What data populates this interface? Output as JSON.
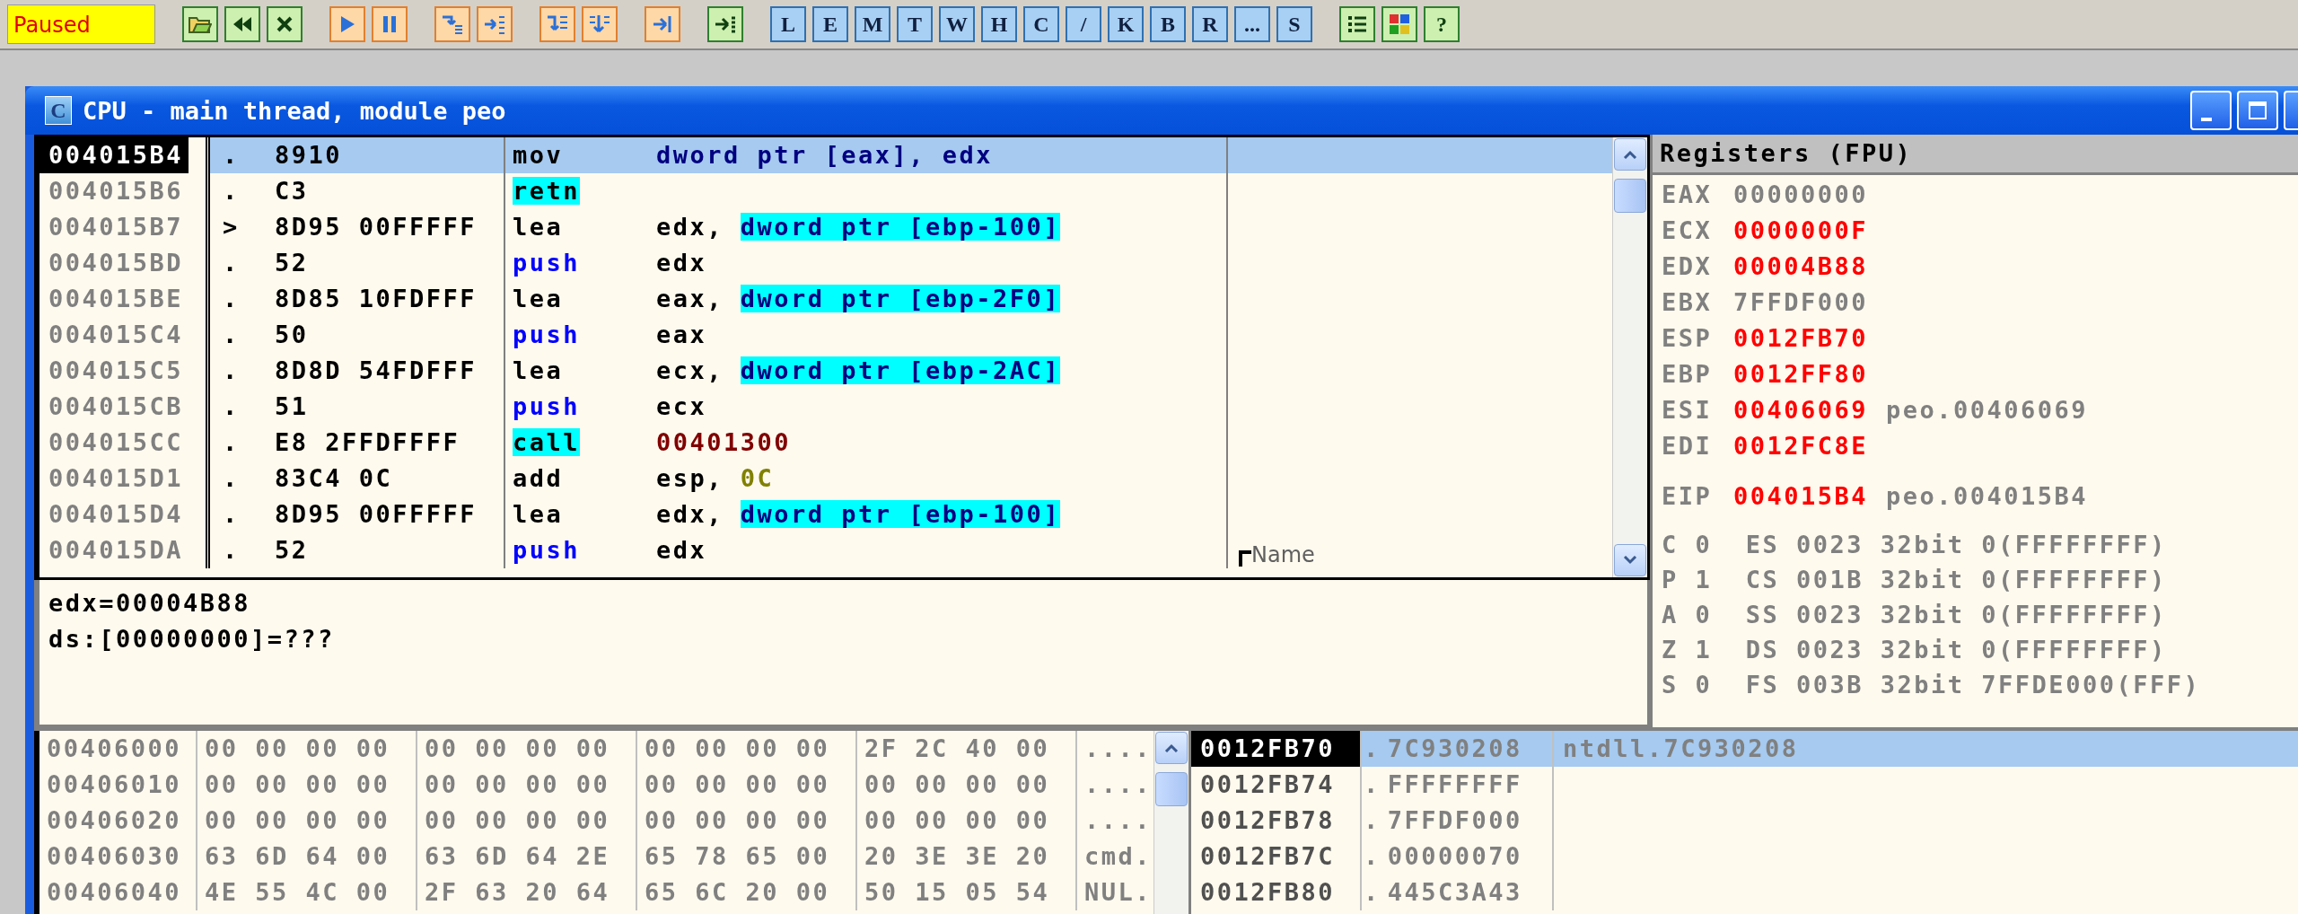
{
  "toolbar": {
    "status": "Paused",
    "letter_buttons": [
      "L",
      "E",
      "M",
      "T",
      "W",
      "H",
      "C",
      "/",
      "K",
      "B",
      "R",
      "...",
      "S"
    ],
    "help_button": "?"
  },
  "window": {
    "icon_letter": "C",
    "title": "CPU - main thread, module peo"
  },
  "disassembly": [
    {
      "address": "004015B4",
      "selected": true,
      "mark": ".",
      "hex": "8910",
      "mnemonic": {
        "text": "mov",
        "kind": "plain"
      },
      "operands": [
        {
          "text": "dword ptr [eax], edx",
          "kind": "memory_write"
        }
      ]
    },
    {
      "address": "004015B6",
      "selected": false,
      "mark": ".",
      "hex": "C3",
      "mnemonic": {
        "text": "retn",
        "kind": "jump"
      }
    },
    {
      "address": "004015B7",
      "selected": false,
      "mark": ">",
      "hex": "8D95 00FFFFF",
      "mnemonic": {
        "text": "lea",
        "kind": "plain"
      },
      "operands": [
        {
          "text": "edx, ",
          "kind": "plain"
        },
        {
          "text": "dword ptr [ebp-100]",
          "kind": "memory"
        }
      ]
    },
    {
      "address": "004015BD",
      "selected": false,
      "mark": ".",
      "hex": "52",
      "mnemonic": {
        "text": "push",
        "kind": "stack"
      },
      "operands": [
        {
          "text": "edx",
          "kind": "plain"
        }
      ]
    },
    {
      "address": "004015BE",
      "selected": false,
      "mark": ".",
      "hex": "8D85 10FDFFF",
      "mnemonic": {
        "text": "lea",
        "kind": "plain"
      },
      "operands": [
        {
          "text": "eax, ",
          "kind": "plain"
        },
        {
          "text": "dword ptr [ebp-2F0]",
          "kind": "memory"
        }
      ]
    },
    {
      "address": "004015C4",
      "selected": false,
      "mark": ".",
      "hex": "50",
      "mnemonic": {
        "text": "push",
        "kind": "stack"
      },
      "operands": [
        {
          "text": "eax",
          "kind": "plain"
        }
      ]
    },
    {
      "address": "004015C5",
      "selected": false,
      "mark": ".",
      "hex": "8D8D 54FDFFF",
      "mnemonic": {
        "text": "lea",
        "kind": "plain"
      },
      "operands": [
        {
          "text": "ecx, ",
          "kind": "plain"
        },
        {
          "text": "dword ptr [ebp-2AC]",
          "kind": "memory"
        }
      ]
    },
    {
      "address": "004015CB",
      "selected": false,
      "mark": ".",
      "hex": "51",
      "mnemonic": {
        "text": "push",
        "kind": "stack"
      },
      "operands": [
        {
          "text": "ecx",
          "kind": "plain"
        }
      ]
    },
    {
      "address": "004015CC",
      "selected": false,
      "mark": ".",
      "hex": "E8 2FFDFFFF",
      "mnemonic": {
        "text": "call",
        "kind": "jump"
      },
      "operands": [
        {
          "text": "00401300",
          "kind": "address"
        }
      ]
    },
    {
      "address": "004015D1",
      "selected": false,
      "mark": ".",
      "hex": "83C4 0C",
      "mnemonic": {
        "text": "add",
        "kind": "plain"
      },
      "operands": [
        {
          "text": "esp, ",
          "kind": "plain"
        },
        {
          "text": "0C",
          "kind": "constant"
        }
      ]
    },
    {
      "address": "004015D4",
      "selected": false,
      "mark": ".",
      "hex": "8D95 00FFFFF",
      "mnemonic": {
        "text": "lea",
        "kind": "plain"
      },
      "operands": [
        {
          "text": "edx, ",
          "kind": "plain"
        },
        {
          "text": "dword ptr [ebp-100]",
          "kind": "memory"
        }
      ]
    },
    {
      "address": "004015DA",
      "selected": false,
      "mark": ".",
      "hex": "52",
      "mnemonic": {
        "text": "push",
        "kind": "stack"
      },
      "operands": [
        {
          "text": "edx",
          "kind": "plain"
        }
      ],
      "comment": "Name"
    }
  ],
  "info": [
    "edx=00004B88",
    "ds:[00000000]=???"
  ],
  "registers": {
    "title": "Registers (FPU)",
    "general": [
      {
        "name": "EAX",
        "value": "00000000",
        "changed": false
      },
      {
        "name": "ECX",
        "value": "0000000F",
        "changed": true
      },
      {
        "name": "EDX",
        "value": "00004B88",
        "changed": true
      },
      {
        "name": "EBX",
        "value": "7FFDF000",
        "changed": false
      },
      {
        "name": "ESP",
        "value": "0012FB70",
        "changed": true
      },
      {
        "name": "EBP",
        "value": "0012FF80",
        "changed": true
      },
      {
        "name": "ESI",
        "value": "00406069",
        "changed": true,
        "comment": "peo.00406069"
      },
      {
        "name": "EDI",
        "value": "0012FC8E",
        "changed": true
      }
    ],
    "eip": {
      "name": "EIP",
      "value": "004015B4",
      "changed": true,
      "comment": "peo.004015B4"
    },
    "flags": [
      "C 0  ES 0023 32bit 0(FFFFFFFF)",
      "P 1  CS 001B 32bit 0(FFFFFFFF)",
      "A 0  SS 0023 32bit 0(FFFFFFFF)",
      "Z 1  DS 0023 32bit 0(FFFFFFFF)",
      "S 0  FS 003B 32bit 7FFDE000(FFF)"
    ]
  },
  "dump": [
    {
      "address": "00406000",
      "groups": [
        "00 00 00 00",
        "00 00 00 00",
        "00 00 00 00",
        "2F 2C 40 00"
      ],
      "ascii": "...."
    },
    {
      "address": "00406010",
      "groups": [
        "00 00 00 00",
        "00 00 00 00",
        "00 00 00 00",
        "00 00 00 00"
      ],
      "ascii": "...."
    },
    {
      "address": "00406020",
      "groups": [
        "00 00 00 00",
        "00 00 00 00",
        "00 00 00 00",
        "00 00 00 00"
      ],
      "ascii": "...."
    },
    {
      "address": "00406030",
      "groups": [
        "63 6D 64 00",
        "63 6D 64 2E",
        "65 78 65 00",
        "20 3E 3E 20"
      ],
      "ascii": "cmd."
    },
    {
      "address": "00406040",
      "groups": [
        "4E 55 4C 00",
        "2F 63 20 64",
        "65 6C 20 00",
        "50 15 05 54"
      ],
      "ascii": "NUL."
    }
  ],
  "stack": [
    {
      "address": "0012FB70",
      "selected": true,
      "mark": ".",
      "value": "7C930208",
      "comment": "ntdll.7C930208"
    },
    {
      "address": "0012FB74",
      "selected": false,
      "mark": ".",
      "value": "FFFFFFFF"
    },
    {
      "address": "0012FB78",
      "selected": false,
      "mark": ".",
      "value": "7FFDF000"
    },
    {
      "address": "0012FB7C",
      "selected": false,
      "mark": ".",
      "value": "00000070"
    },
    {
      "address": "0012FB80",
      "selected": false,
      "mark": ".",
      "value": "445C3A43"
    }
  ]
}
